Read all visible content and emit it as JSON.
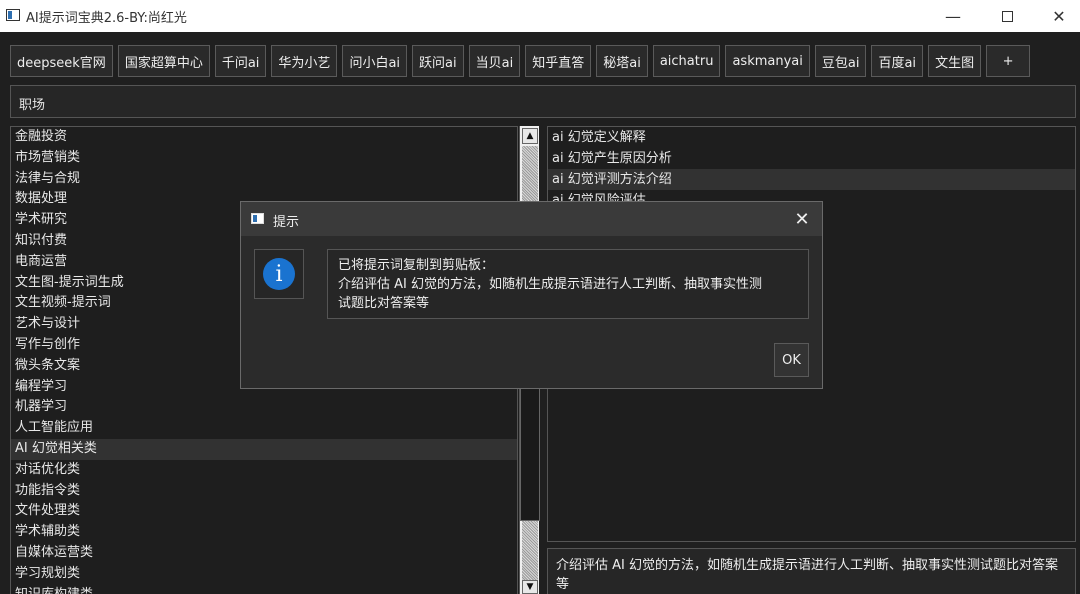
{
  "window": {
    "title": "AI提示词宝典2.6-BY:尚红光",
    "minimize": "—",
    "close": "✕"
  },
  "toolbar": {
    "buttons": [
      "deepseek官网",
      "国家超算中心",
      "千问ai",
      "华为小艺",
      "问小白ai",
      "跃问ai",
      "当贝ai",
      "知乎直答",
      "秘塔ai",
      "aichatru",
      "askmanyai",
      "豆包ai",
      "百度ai",
      "文生图"
    ],
    "add_label": "+"
  },
  "category_field": {
    "value": "职场"
  },
  "categories": {
    "items": [
      "金融投资",
      "市场营销类",
      "法律与合规",
      "数据处理",
      "学术研究",
      "知识付费",
      "电商运营",
      "文生图-提示词生成",
      "文生视频-提示词",
      "艺术与设计",
      "写作与创作",
      "微头条文案",
      "编程学习",
      "机器学习",
      "人工智能应用",
      "AI 幻觉相关类",
      "对话优化类",
      "功能指令类",
      "文件处理类",
      "学术辅助类",
      "自媒体运营类",
      "学习规划类",
      "知识库构建类"
    ],
    "selected": "AI 幻觉相关类"
  },
  "scrollbar": {
    "up_arrow": "▲",
    "down_arrow": "▼"
  },
  "prompts": {
    "items": [
      "ai 幻觉定义解释",
      "ai 幻觉产生原因分析",
      "ai 幻觉评测方法介绍",
      "ai 幻觉风险评估"
    ],
    "selected": "ai 幻觉评测方法介绍"
  },
  "preview": {
    "text": "介绍评估 AI 幻觉的方法，如随机生成提示语进行人工判断、抽取事实性测试题比对答案等"
  },
  "dialog": {
    "title": "提示",
    "close": "✕",
    "info_glyph": "i",
    "message_line1": "已将提示词复制到剪贴板：",
    "message_line2": "介绍评估 AI 幻觉的方法，如随机生成提示语进行人工判断、抽取事实性测",
    "message_line3": "试题比对答案等",
    "ok_label": "OK"
  },
  "colors": {
    "background": "#1f1f1f",
    "panel": "#262626",
    "border": "#555555",
    "selected_row": "#323232",
    "info_blue": "#1a73d0",
    "titlebar": "#ffffff"
  }
}
